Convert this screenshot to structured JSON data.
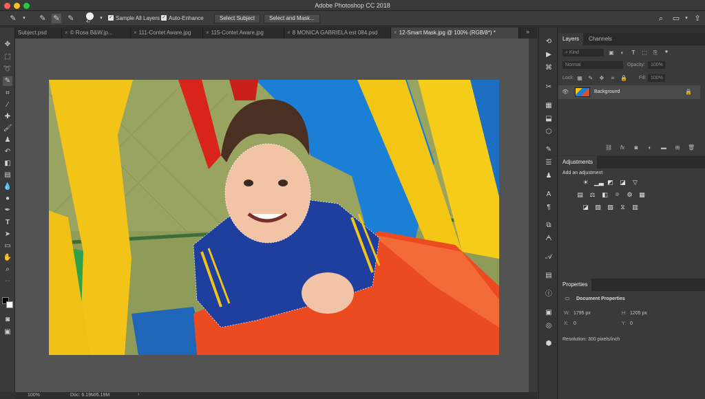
{
  "app": {
    "title": "Adobe Photoshop CC 2018"
  },
  "options_bar": {
    "brush_size": "47",
    "sample_all_layers": "Sample All Layers",
    "auto_enhance": "Auto-Enhance",
    "select_subject": "Select Subject",
    "select_and_mask": "Select and Mask..."
  },
  "tabs": [
    {
      "label": "Subject.psd"
    },
    {
      "label": "© Rosa B&W.jp..."
    },
    {
      "label": "111-Contet Aware.jpg"
    },
    {
      "label": "115-Contet Aware.jpg"
    },
    {
      "label": "8 MONICA GABRIELA est 084.psd"
    },
    {
      "label": "12-Smart Mask.jpg @ 100% (RGB/8*) *"
    }
  ],
  "tabs_overflow": "»",
  "status": {
    "zoom": "100%",
    "doc": "Doc: 6.19M/6.19M",
    "arrow": "›"
  },
  "layers_panel": {
    "tabs": [
      "Layers",
      "Channels"
    ],
    "filter_kind": "Kind",
    "blend_mode": "Normal",
    "opacity_label": "Opacity:",
    "opacity_value": "100%",
    "lock_label": "Lock:",
    "fill_label": "Fill:",
    "fill_value": "100%",
    "layer_name": "Background"
  },
  "adjustments_panel": {
    "title": "Adjustments",
    "subtitle": "Add an adjustment"
  },
  "properties_panel": {
    "title": "Properties",
    "header": "Document Properties",
    "w_label": "W:",
    "w_value": "1795 px",
    "h_label": "H:",
    "h_value": "1205 px",
    "x_label": "X:",
    "x_value": "0",
    "y_label": "Y:",
    "y_value": "0",
    "resolution": "Resolution: 300 pixels/inch"
  },
  "colors": {
    "accent_panel": "#3a3a3a",
    "close_red": "#fc5f57",
    "minimize_yellow": "#fdbc2e",
    "zoom_green": "#28c840"
  }
}
